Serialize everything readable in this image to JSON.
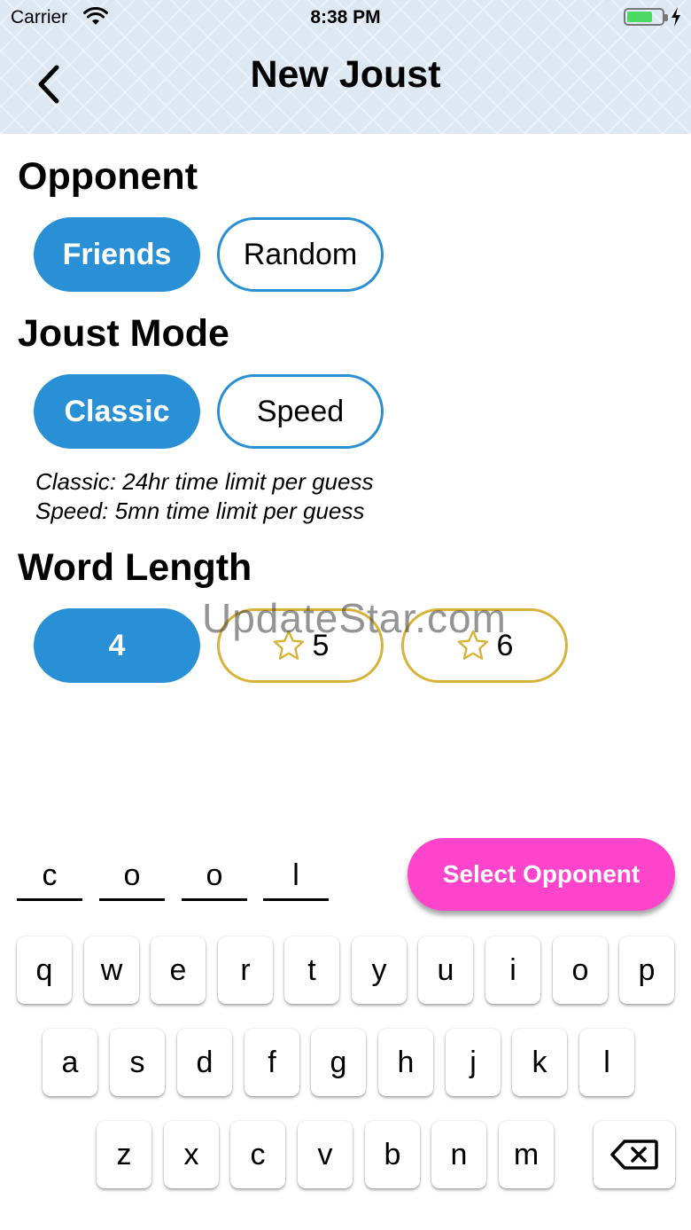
{
  "status_bar": {
    "carrier": "Carrier",
    "time": "8:38 PM"
  },
  "nav": {
    "title": "New Joust"
  },
  "opponent": {
    "title": "Opponent",
    "options": [
      {
        "label": "Friends",
        "selected": true
      },
      {
        "label": "Random",
        "selected": false
      }
    ]
  },
  "joust_mode": {
    "title": "Joust Mode",
    "options": [
      {
        "label": "Classic",
        "selected": true
      },
      {
        "label": "Speed",
        "selected": false
      }
    ],
    "descriptions": [
      "Classic: 24hr time limit per guess",
      "Speed: 5mn time limit per guess"
    ]
  },
  "word_length": {
    "title": "Word Length",
    "options": [
      {
        "label": "4",
        "selected": true,
        "locked": false
      },
      {
        "label": "5",
        "selected": false,
        "locked": true
      },
      {
        "label": "6",
        "selected": false,
        "locked": true
      }
    ]
  },
  "watermark": "UpdateStar.com",
  "word_slots": [
    "c",
    "o",
    "o",
    "l"
  ],
  "select_button": {
    "label": "Select Opponent"
  },
  "keyboard": {
    "row1": [
      "q",
      "w",
      "e",
      "r",
      "t",
      "y",
      "u",
      "i",
      "o",
      "p"
    ],
    "row2": [
      "a",
      "s",
      "d",
      "f",
      "g",
      "h",
      "j",
      "k",
      "l"
    ],
    "row3": [
      "z",
      "x",
      "c",
      "v",
      "b",
      "n",
      "m"
    ],
    "backspace_icon": "backspace-icon"
  },
  "colors": {
    "accent_blue": "#2a90d6",
    "select_pink": "#ff44cc",
    "locked_gold": "#d9b23a",
    "battery_green": "#4cd964"
  }
}
